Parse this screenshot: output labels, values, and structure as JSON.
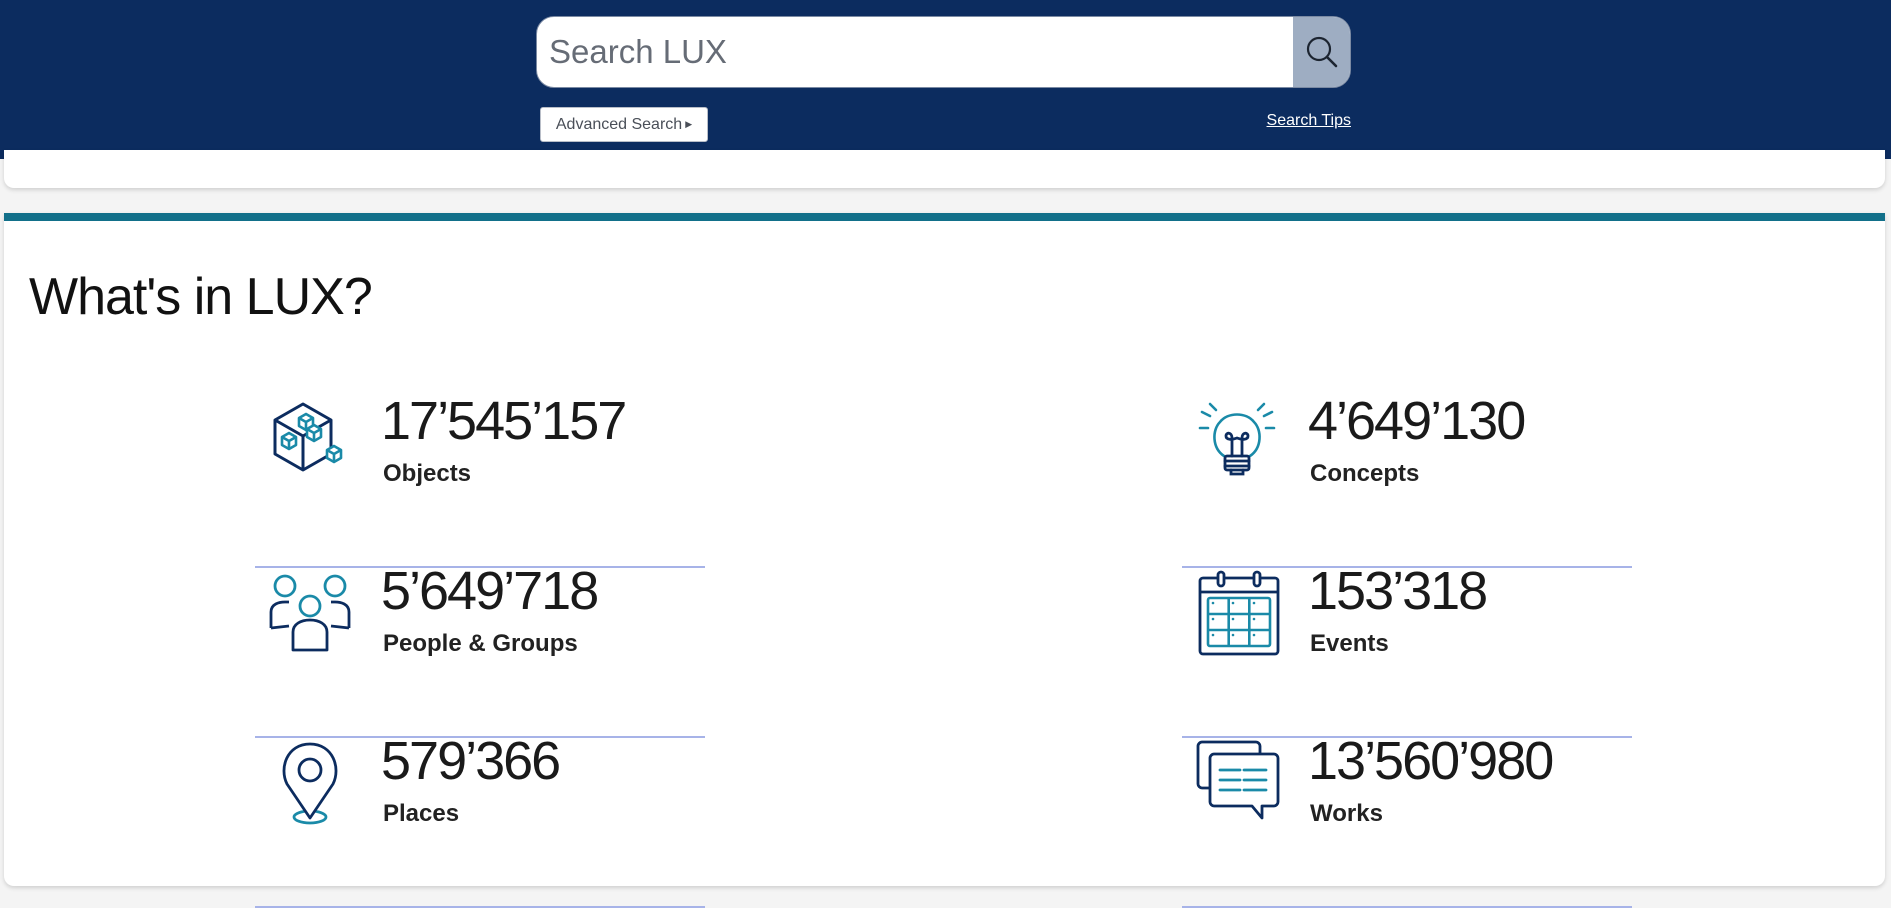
{
  "header": {
    "search": {
      "placeholder": "Search LUX",
      "value": ""
    },
    "search_button_icon": "search-icon",
    "advanced_search_label": "Advanced Search",
    "advanced_search_icon": "caret-right-icon",
    "search_tips_label": "Search Tips"
  },
  "section": {
    "title": "What's in LUX?",
    "stats": [
      {
        "count": "17’545’157",
        "label": "Objects",
        "icon": "objects-cubes-icon"
      },
      {
        "count": "4’649’130",
        "label": "Concepts",
        "icon": "lightbulb-icon"
      },
      {
        "count": "5’649’718",
        "label": "People & Groups",
        "icon": "people-groups-icon"
      },
      {
        "count": "153’318",
        "label": "Events",
        "icon": "calendar-icon"
      },
      {
        "count": "579’366",
        "label": "Places",
        "icon": "map-pin-icon"
      },
      {
        "count": "13’560’980",
        "label": "Works",
        "icon": "chat-document-icon"
      }
    ]
  },
  "colors": {
    "header_bg": "#0c2c5f",
    "accent_teal": "#12708a",
    "icon_navy": "#0c2c5f",
    "icon_teal": "#1a8aa8",
    "divider": "#a7b3e8"
  }
}
